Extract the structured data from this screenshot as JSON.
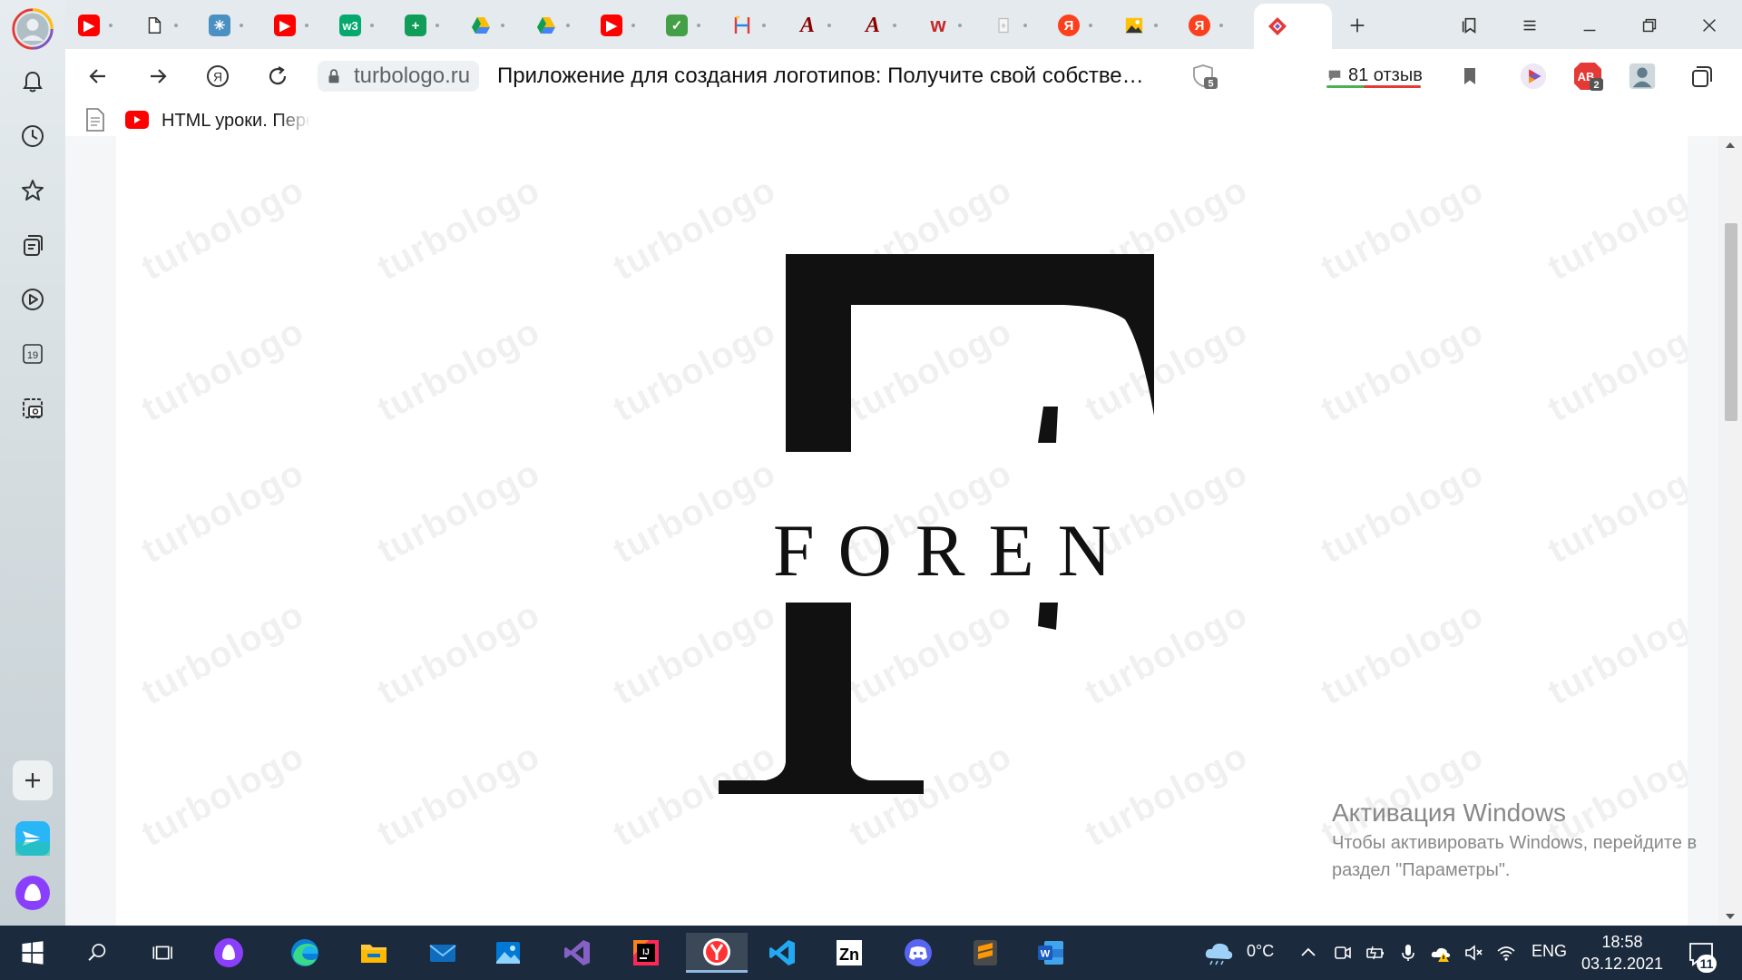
{
  "browser": {
    "address": {
      "domain": "turbologo.ru",
      "page_title": "Приложение для создания логотипов: Получите свой собстве…"
    },
    "protect_badge": "5",
    "reviews_label": "81 отзыв",
    "adblock_badge": "2",
    "bookmarks": [
      {
        "label": "HTML уроки. Пере"
      }
    ]
  },
  "content": {
    "logo_word": "FOREN",
    "watermark_text": "turbologo",
    "activation": {
      "title": "Активация Windows",
      "body": "Чтобы активировать Windows, перейдите в раздел \"Параметры\"."
    }
  },
  "sidebar": {
    "calendar_day": "19"
  },
  "taskbar": {
    "weather": "0°C",
    "language": "ENG",
    "time": "18:58",
    "date": "03.12.2021",
    "notifications_count": "11"
  },
  "colors": {
    "taskbar_bg": "#1b2a3d",
    "youtube_red": "#ff0000",
    "active_tab_accent": "#e53935"
  }
}
